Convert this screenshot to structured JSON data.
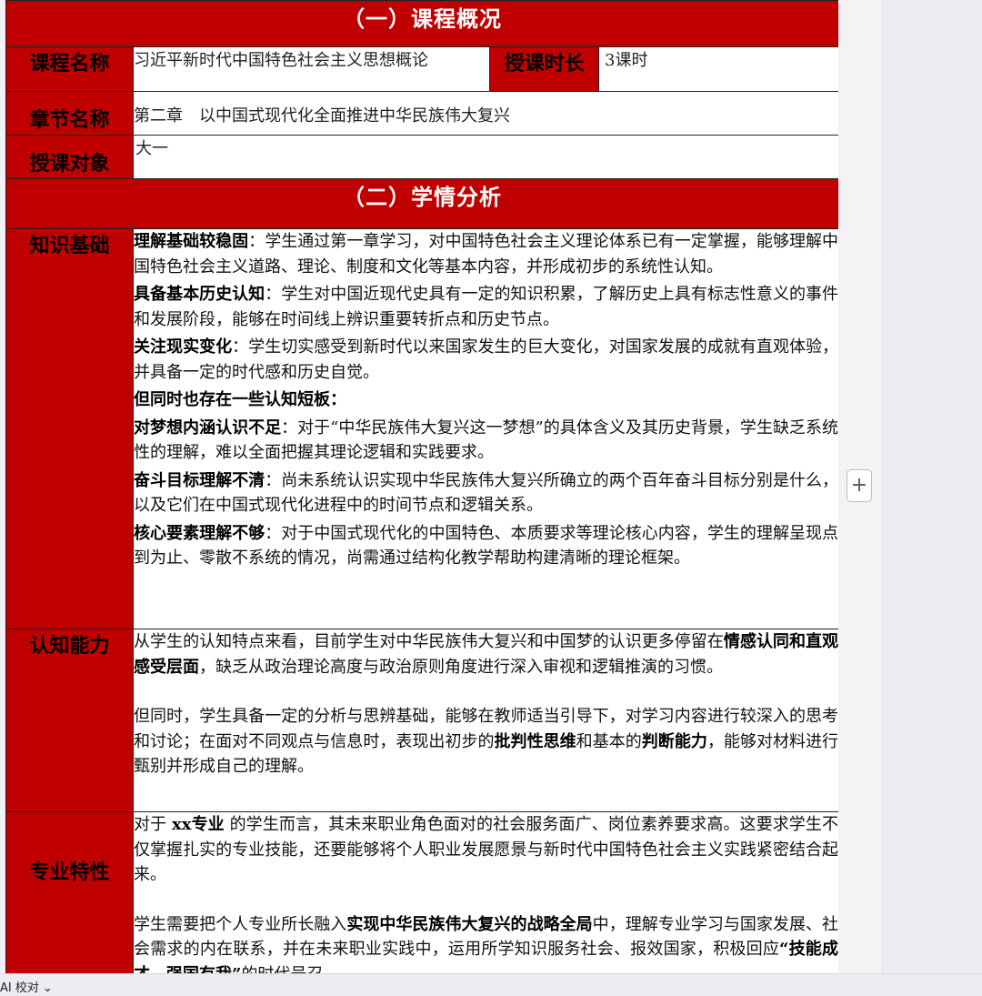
{
  "section1": {
    "title": "（一）课程概况"
  },
  "course": {
    "name_label": "课程名称",
    "name_value": "习近平新时代中国特色社会主义思想概论",
    "hours_label": "授课时长",
    "hours_value": "3课时",
    "chapter_label": "章节名称",
    "chapter_value": "第二章　以中国式现代化全面推进中华民族伟大复兴",
    "audience_label": "授课对象",
    "audience_value": "大一"
  },
  "section2": {
    "title": "（二）学情分析"
  },
  "knowledge": {
    "label": "知识基础",
    "items": [
      {
        "bold": "理解基础较稳固",
        "text": "：学生通过第一章学习，对中国特色社会主义理论体系已有一定掌握，能够理解中国特色社会主义道路、理论、制度和文化等基本内容，并形成初步的系统性认知。"
      },
      {
        "bold": "具备基本历史认知",
        "text": "：学生对中国近现代史具有一定的知识积累，了解历史上具有标志性意义的事件和发展阶段，能够在时间线上辨识重要转折点和历史节点。"
      },
      {
        "bold": "关注现实变化",
        "text": "：学生切实感受到新时代以来国家发生的巨大变化，对国家发展的成就有直观体验，并具备一定的时代感和历史自觉。"
      },
      {
        "bold": "但同时也存在一些认知短板：",
        "text": ""
      },
      {
        "bold": "对梦想内涵认识不足",
        "text": "：对于“中华民族伟大复兴这一梦想”的具体含义及其历史背景，学生缺乏系统性的理解，难以全面把握其理论逻辑和实践要求。"
      },
      {
        "bold": "奋斗目标理解不清",
        "text": "：尚未系统认识实现中华民族伟大复兴所确立的两个百年奋斗目标分别是什么，以及它们在中国式现代化进程中的时间节点和逻辑关系。"
      },
      {
        "bold": "核心要素理解不够",
        "text": "：对于中国式现代化的中国特色、本质要求等理论核心内容，学生的理解呈现点到为止、零散不系统的情况，尚需通过结构化教学帮助构建清晰的理论框架。"
      }
    ]
  },
  "cognitive": {
    "label": "认知能力",
    "p1_a": "从学生的认知特点来看，目前学生对中华民族伟大复兴和中国梦的认识更多停留在",
    "p1_b": "情感认同和直观感受层面",
    "p1_c": "，缺乏从政治理论高度与政治原则角度进行深入审视和逻辑推演的习惯。",
    "p2_a": "但同时，学生具备一定的分析与思辨基础，能够在教师适当引导下，对学习内容进行较深入的思考和讨论；在面对不同观点与信息时，表现出初步的",
    "p2_b": "批判性思维",
    "p2_c": "和基本的",
    "p2_d": "判断能力",
    "p2_e": "，能够对材料进行甄别并形成自己的理解。"
  },
  "major": {
    "label": "专业特性",
    "p1_a": "对于 ",
    "p1_b": "xx专业",
    "p1_c": " 的学生而言，其未来职业角色面对的社会服务面广、岗位素养要求高。这要求学生不仅掌握扎实的专业技能，还要能够将个人职业发展愿景与新时代中国特色社会主义实践紧密结合起来。",
    "p2_a": "学生需要把个人专业所长融入",
    "p2_b": "实现中华民族伟大复兴的战略全局",
    "p2_c": "中，理解专业学习与国家发展、社会需求的内在联系，并在未来职业实践中，运用所学知识服务社会、报效国家，积极回应",
    "p2_d": "“技能成才、强国有我”",
    "p2_e": "的时代号召。"
  },
  "ui": {
    "add_button": "+",
    "status_label": "AI 校对 ⌄"
  }
}
